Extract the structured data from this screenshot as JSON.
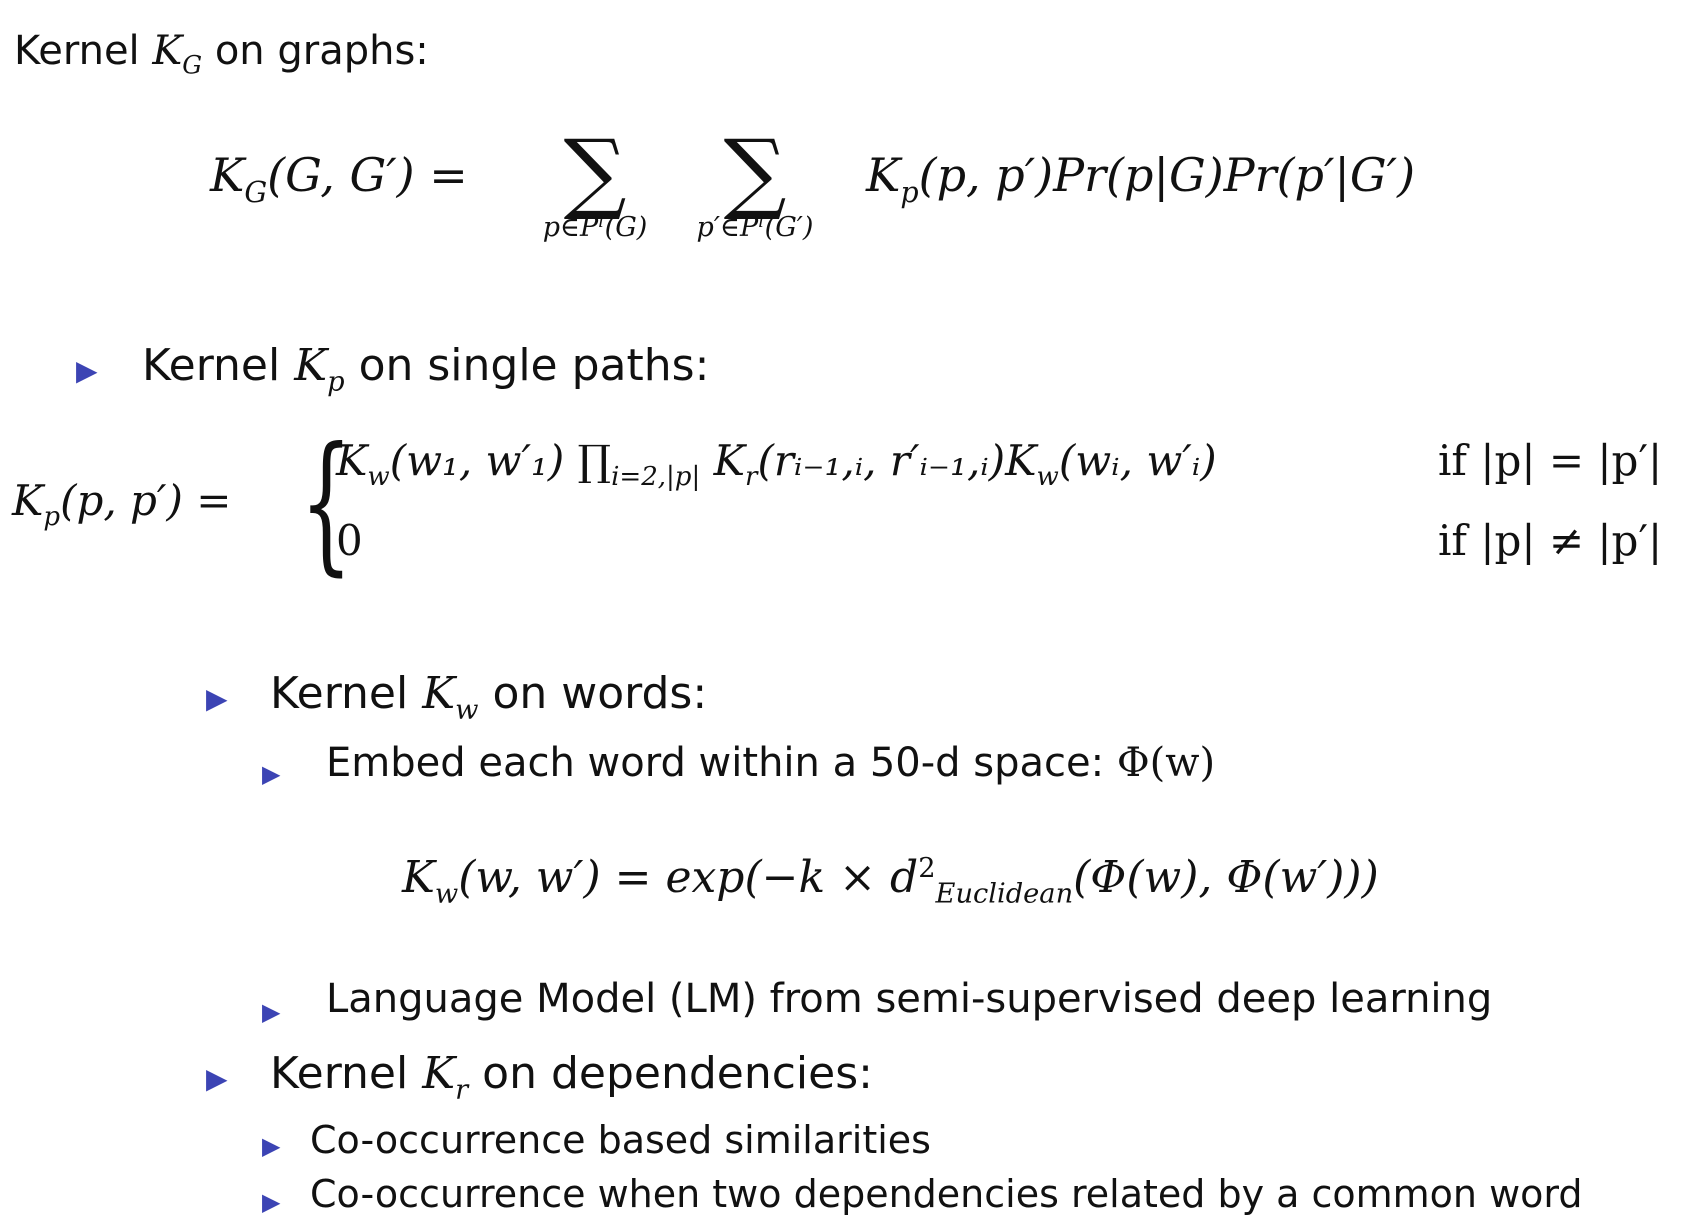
{
  "heading": {
    "label": "Kernel",
    "symbol": "K",
    "symbol_sub": "G",
    "suffix": "on graphs:"
  },
  "formula_g": {
    "lhs": "K",
    "lhs_sub": "G",
    "lhs_args": "(G, G′) =",
    "sum1_limit": "p∈Pˡ(G)",
    "sum2_limit": "p′∈Pˡ(G′)",
    "body_k": "K",
    "body_k_sub": "p",
    "body_rest": "(p, p′)Pr(p|G)Pr(p′|G′)"
  },
  "bullets": {
    "kp": {
      "label": "Kernel",
      "symbol": "K",
      "symbol_sub": "p",
      "suffix": "on single paths:"
    },
    "kw": {
      "label": "Kernel",
      "symbol": "K",
      "symbol_sub": "w",
      "suffix": "on words:"
    },
    "embed": {
      "text": "Embed each word within a 50-d space:",
      "math": "Φ(w)"
    },
    "lm": {
      "text": "Language Model (LM) from semi-supervised deep learning"
    },
    "kr": {
      "label": "Kernel",
      "symbol": "K",
      "symbol_sub": "r",
      "suffix": "on dependencies:"
    },
    "cooc1": {
      "text": "Co-occurrence based similarities"
    },
    "cooc2": {
      "text": "Co-occurrence when two dependencies related by a common word"
    }
  },
  "formula_p": {
    "lhs_k": "K",
    "lhs_sub": "p",
    "lhs_args": "(p, p′) =",
    "case1_a": "K",
    "case1_a_sub": "w",
    "case1_b": "(w₁, w′₁) ∏",
    "case1_prod_sub": "i=2,|p|",
    "case1_c": "K",
    "case1_c_sub": "r",
    "case1_d": "(rᵢ₋₁,ᵢ, r′ᵢ₋₁,ᵢ)",
    "case1_e": "K",
    "case1_e_sub": "w",
    "case1_f": "(wᵢ, w′ᵢ)",
    "case1_cond": "if |p| = |p′|",
    "case2_val": "0",
    "case2_cond": "if |p| ≠ |p′|"
  },
  "formula_w": {
    "k": "K",
    "k_sub": "w",
    "args": "(w, w′) = exp(−k × d",
    "sup": "2",
    "sub": "Euclidean",
    "tail": "(Φ(w), Φ(w′)))"
  },
  "colors": {
    "bullet": "#3c44b4",
    "text": "#111111",
    "background": "#ffffff"
  },
  "icons": {
    "bullet": "triangle-right-icon"
  }
}
